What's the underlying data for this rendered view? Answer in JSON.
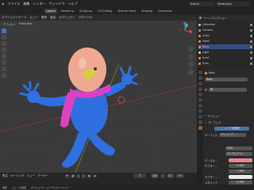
{
  "menu": {
    "items": [
      "ファイル",
      "編集",
      "レンダー",
      "ウィンドウ",
      "ヘルプ"
    ]
  },
  "workspaces": [
    "Layout",
    "Modeling",
    "Sculpting",
    "UV Editing",
    "Texture Paint",
    "Shading",
    "Animation"
  ],
  "active_workspace": "Layout",
  "scene": "Scene",
  "view_layer": "ViewLayer",
  "viewport": {
    "mode": "オブジェクトモード",
    "view": "ビュー",
    "select": "選択",
    "add": "追加",
    "object": "オブジェクト",
    "orientation": "グローバル",
    "sub_label": "デフォルト",
    "select_box": "Select Box"
  },
  "timeline": {
    "menu": [
      "再生",
      "キーイング",
      "ビュー",
      "マーカー"
    ],
    "frame": "1",
    "start_label": "開始",
    "start": "1",
    "end_label": "終了",
    "end": "250"
  },
  "statusbar": [
    "選択",
    "ビューを回転",
    "オブジェクト コンテキストメニュー"
  ],
  "outliner": {
    "title": "シーンコレクション",
    "rows": [
      {
        "label": "Collection",
        "color": "#bdbdbd",
        "selected": false
      },
      {
        "label": "Camera",
        "color": "#6db24f",
        "selected": false
      },
      {
        "label": "Cube",
        "color": "#e08a3a",
        "selected": false
      },
      {
        "label": "Head",
        "color": "#e08a3a",
        "selected": false
      },
      {
        "label": "Body",
        "color": "#e08a3a",
        "selected": true
      },
      {
        "label": "Light",
        "color": "#e8d84a",
        "selected": false
      },
      {
        "label": "Scarf",
        "color": "#e08a3a",
        "selected": false
      },
      {
        "label": "Eyes",
        "color": "#e08a3a",
        "selected": false
      }
    ]
  },
  "properties": {
    "object": "Body",
    "material_slot": "Body",
    "material": "体",
    "preview": "プレビュー",
    "surface_section": "サーフェス",
    "use_nodes": "ノードを使用",
    "surface_label": "サーフェス",
    "surface_value": "プリンシプ...",
    "ggx": "GGX",
    "random_walk": "ランダムウォ...",
    "base_color_label": "ベースカ...",
    "base_color": "#e8868c",
    "subsurface_label": "サブサー...",
    "subsurface_value": "0.000",
    "subsurface_radius": "1.000",
    "subsurface_color_label": "サブサー...",
    "subsurface_color": "#e9e9e9",
    "metallic_label": "メタリック",
    "metallic_value": "0.000"
  },
  "colors": {
    "accent": "#4772b3",
    "viewport_bg": "#3a3a3a",
    "character_body": "#2f6fe0",
    "character_head": "#f0a890",
    "scarf": "#e040c0"
  }
}
